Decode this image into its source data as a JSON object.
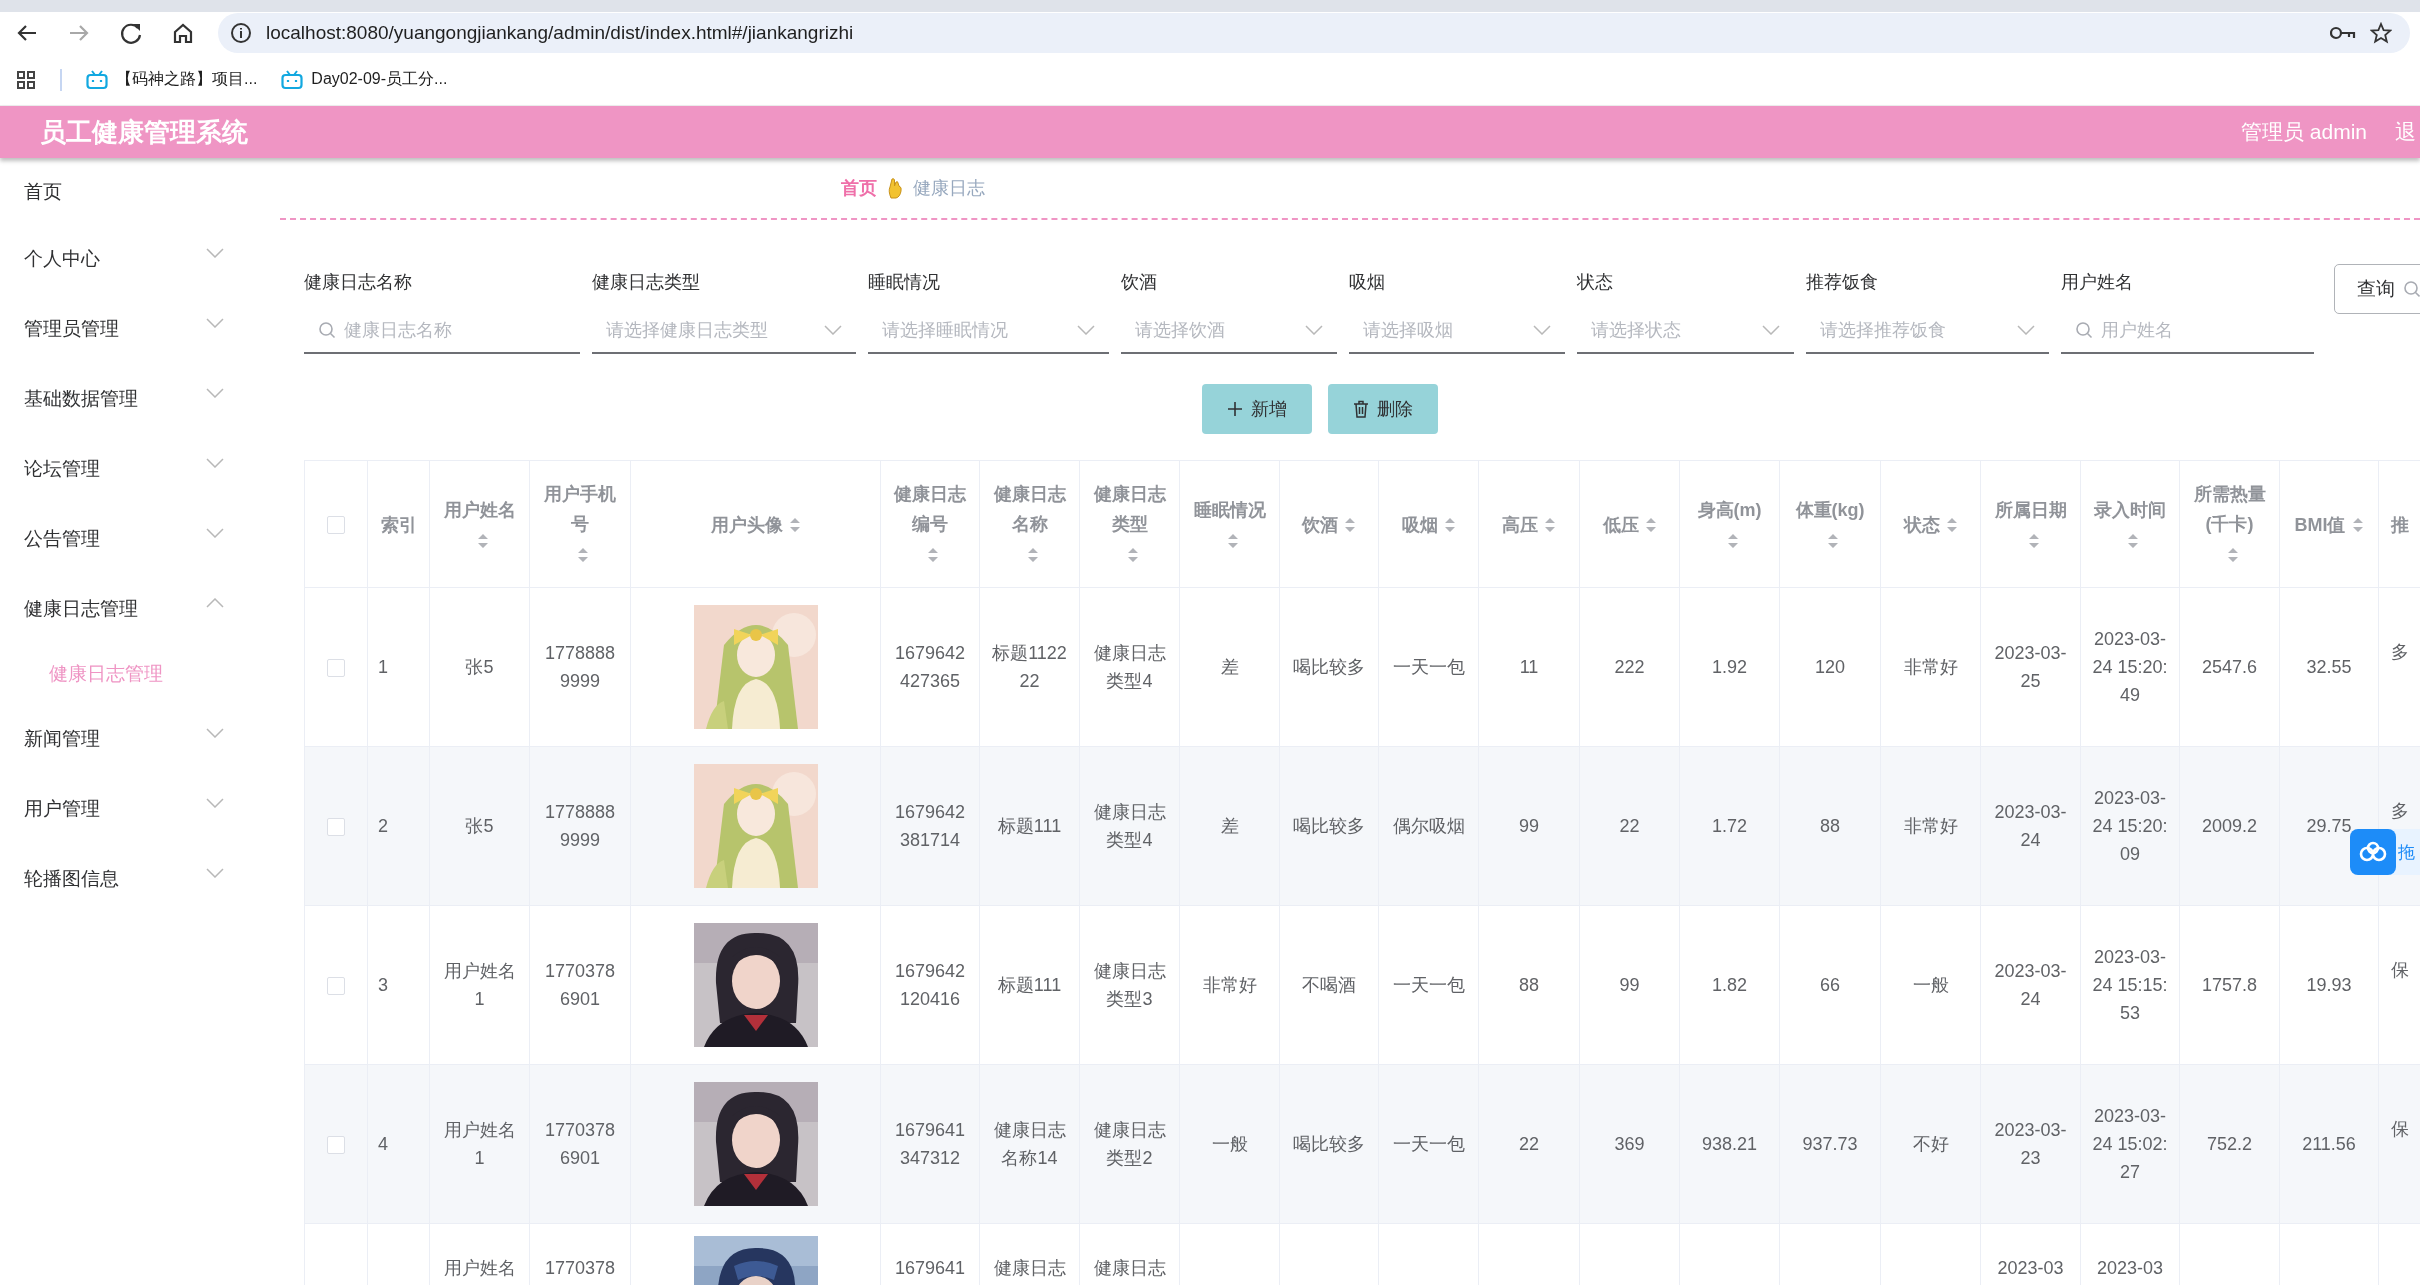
{
  "browser": {
    "url": "localhost:8080/yuangongjiankang/admin/dist/index.html#/jiankangrizhi",
    "forward_disabled": true,
    "bookmarks": [
      {
        "label": "【码神之路】项目..."
      },
      {
        "label": "Day02-09-员工分..."
      }
    ]
  },
  "header": {
    "title": "员工健康管理系统",
    "user": "管理员 admin",
    "logout": "退"
  },
  "sidebar": {
    "items": [
      {
        "label": "首页",
        "kind": "link"
      },
      {
        "label": "个人中心",
        "kind": "submenu",
        "expanded": false
      },
      {
        "label": "管理员管理",
        "kind": "submenu",
        "expanded": false
      },
      {
        "label": "基础数据管理",
        "kind": "submenu",
        "expanded": false
      },
      {
        "label": "论坛管理",
        "kind": "submenu",
        "expanded": false
      },
      {
        "label": "公告管理",
        "kind": "submenu",
        "expanded": false
      },
      {
        "label": "健康日志管理",
        "kind": "submenu",
        "expanded": true,
        "children": [
          {
            "label": "健康日志管理",
            "selected": true
          }
        ]
      },
      {
        "label": "新闻管理",
        "kind": "submenu",
        "expanded": false
      },
      {
        "label": "用户管理",
        "kind": "submenu",
        "expanded": false
      },
      {
        "label": "轮播图信息",
        "kind": "submenu",
        "expanded": false
      }
    ]
  },
  "breadcrumb": [
    {
      "label": "首页",
      "current": false
    },
    {
      "label": "健康日志",
      "current": true
    }
  ],
  "filters": [
    {
      "label": "健康日志名称",
      "kind": "search",
      "placeholder": "健康日志名称"
    },
    {
      "label": "健康日志类型",
      "kind": "select",
      "placeholder": "请选择健康日志类型"
    },
    {
      "label": "睡眠情况",
      "kind": "select",
      "placeholder": "请选择睡眠情况"
    },
    {
      "label": "饮酒",
      "kind": "select",
      "placeholder": "请选择饮酒"
    },
    {
      "label": "吸烟",
      "kind": "select",
      "placeholder": "请选择吸烟"
    },
    {
      "label": "状态",
      "kind": "select",
      "placeholder": "请选择状态"
    },
    {
      "label": "推荐饭食",
      "kind": "select",
      "placeholder": "请选择推荐饭食"
    },
    {
      "label": "用户姓名",
      "kind": "search",
      "placeholder": "用户姓名"
    }
  ],
  "query_button": "查询",
  "actions": [
    {
      "label": "新增",
      "kind": "add"
    },
    {
      "label": "删除",
      "kind": "delete"
    }
  ],
  "table": {
    "select_all": {
      "checked": false
    },
    "columns": [
      {
        "label": "索引",
        "kind": "text",
        "sortable": false
      },
      {
        "label": "用户姓名",
        "kind": "text",
        "sortable": true
      },
      {
        "label": "用户手机号",
        "kind": "text",
        "sortable": true
      },
      {
        "label": "用户头像",
        "kind": "picture",
        "sortable": true
      },
      {
        "label": "健康日志编号",
        "kind": "text",
        "sortable": true
      },
      {
        "label": "健康日志名称",
        "kind": "text",
        "sortable": true
      },
      {
        "label": "健康日志类型",
        "kind": "text",
        "sortable": true
      },
      {
        "label": "睡眠情况",
        "kind": "text",
        "sortable": true
      },
      {
        "label": "饮酒",
        "kind": "text",
        "sortable": true
      },
      {
        "label": "吸烟",
        "kind": "text",
        "sortable": true
      },
      {
        "label": "高压",
        "kind": "text",
        "sortable": true
      },
      {
        "label": "低压",
        "kind": "text",
        "sortable": true
      },
      {
        "label": "身高(m)",
        "kind": "text",
        "sortable": true
      },
      {
        "label": "体重(kg)",
        "kind": "text",
        "sortable": true
      },
      {
        "label": "状态",
        "kind": "text",
        "sortable": true
      },
      {
        "label": "所属日期",
        "kind": "text",
        "sortable": true
      },
      {
        "label": "录入时间",
        "kind": "text",
        "sortable": true
      },
      {
        "label": "所需热量(千卡)",
        "kind": "text",
        "sortable": true
      },
      {
        "label": "BMI值",
        "kind": "text",
        "sortable": true
      },
      {
        "label": "推",
        "kind": "text",
        "sortable": false
      }
    ],
    "rows": [
      {
        "checked": false,
        "cells": [
          "1",
          "张5",
          "17788889999",
          {
            "kind": "picture"
          },
          "1679642427365",
          "标题112222",
          "健康日志类型4",
          "差",
          "喝比较多",
          "一天一包",
          "11",
          "222",
          "1.92",
          "120",
          "非常好",
          "2023-03-25",
          "2023-03-24 15:20:49",
          "2547.6",
          "32.55",
          "多"
        ]
      },
      {
        "checked": false,
        "cells": [
          "2",
          "张5",
          "17788889999",
          {
            "kind": "picture"
          },
          "1679642381714",
          "标题111",
          "健康日志类型4",
          "差",
          "喝比较多",
          "偶尔吸烟",
          "99",
          "22",
          "1.72",
          "88",
          "非常好",
          "2023-03-24",
          "2023-03-24 15:20:09",
          "2009.2",
          "29.75",
          "多"
        ]
      },
      {
        "checked": false,
        "cells": [
          "3",
          "用户姓名1",
          "17703786901",
          {
            "kind": "picture"
          },
          "1679642120416",
          "标题111",
          "健康日志类型3",
          "非常好",
          "不喝酒",
          "一天一包",
          "88",
          "99",
          "1.82",
          "66",
          "一般",
          "2023-03-24",
          "2023-03-24 15:15:53",
          "1757.8",
          "19.93",
          "保"
        ]
      },
      {
        "checked": false,
        "cells": [
          "4",
          "用户姓名1",
          "17703786901",
          {
            "kind": "picture"
          },
          "1679641347312",
          "健康日志名称14",
          "健康日志类型2",
          "一般",
          "喝比较多",
          "一天一包",
          "22",
          "369",
          "938.21",
          "937.73",
          "不好",
          "2023-03-23",
          "2023-03-24 15:02:27",
          "752.2",
          "211.56",
          "保"
        ]
      },
      {
        "cells": [
          null,
          "用户姓名",
          "1770378",
          {
            "kind": "picture"
          },
          "1679641",
          "健康日志",
          "健康日志",
          null,
          null,
          null,
          null,
          null,
          null,
          null,
          null,
          "2023-03",
          "2023-03",
          null,
          null,
          null
        ]
      }
    ]
  },
  "floating_widget": {
    "label": "拖"
  }
}
